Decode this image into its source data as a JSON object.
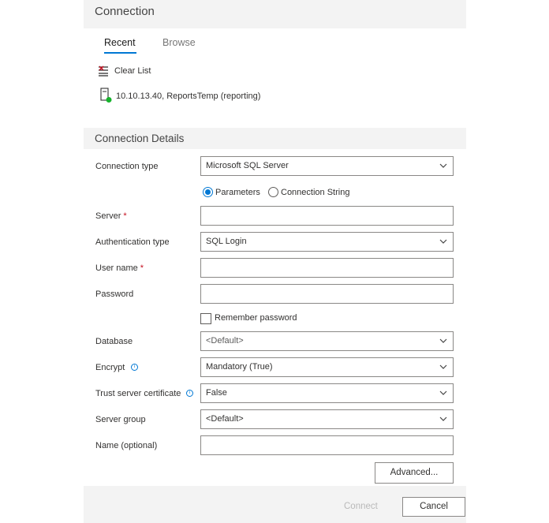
{
  "header": {
    "title": "Connection"
  },
  "tabs": [
    {
      "label": "Recent"
    },
    {
      "label": "Browse"
    }
  ],
  "recent": {
    "clear_label": "Clear List",
    "items": [
      {
        "label": "10.10.13.40, ReportsTemp (reporting)",
        "status_color": "#16b32c"
      }
    ]
  },
  "details": {
    "title": "Connection Details",
    "connection_type": {
      "label": "Connection type",
      "value": "Microsoft SQL Server"
    },
    "mode": {
      "parameters": "Parameters",
      "connection_string": "Connection String",
      "selected": "Parameters"
    },
    "server": {
      "label": "Server",
      "required": "*",
      "value": ""
    },
    "auth": {
      "label": "Authentication type",
      "value": "SQL Login"
    },
    "username": {
      "label": "User name",
      "required": "*",
      "value": ""
    },
    "password": {
      "label": "Password",
      "value": ""
    },
    "remember": {
      "label": "Remember password",
      "checked": false
    },
    "database": {
      "label": "Database",
      "value": "<Default>"
    },
    "encrypt": {
      "label": "Encrypt",
      "value": "Mandatory (True)"
    },
    "trust": {
      "label": "Trust server certificate",
      "value": "False"
    },
    "server_group": {
      "label": "Server group",
      "value": "<Default>"
    },
    "name": {
      "label": "Name (optional)",
      "value": ""
    },
    "advanced": "Advanced..."
  },
  "footer": {
    "connect": "Connect",
    "cancel": "Cancel"
  },
  "colors": {
    "accent": "#0078d4",
    "required": "#c50f1f",
    "status": "#16b32c"
  }
}
